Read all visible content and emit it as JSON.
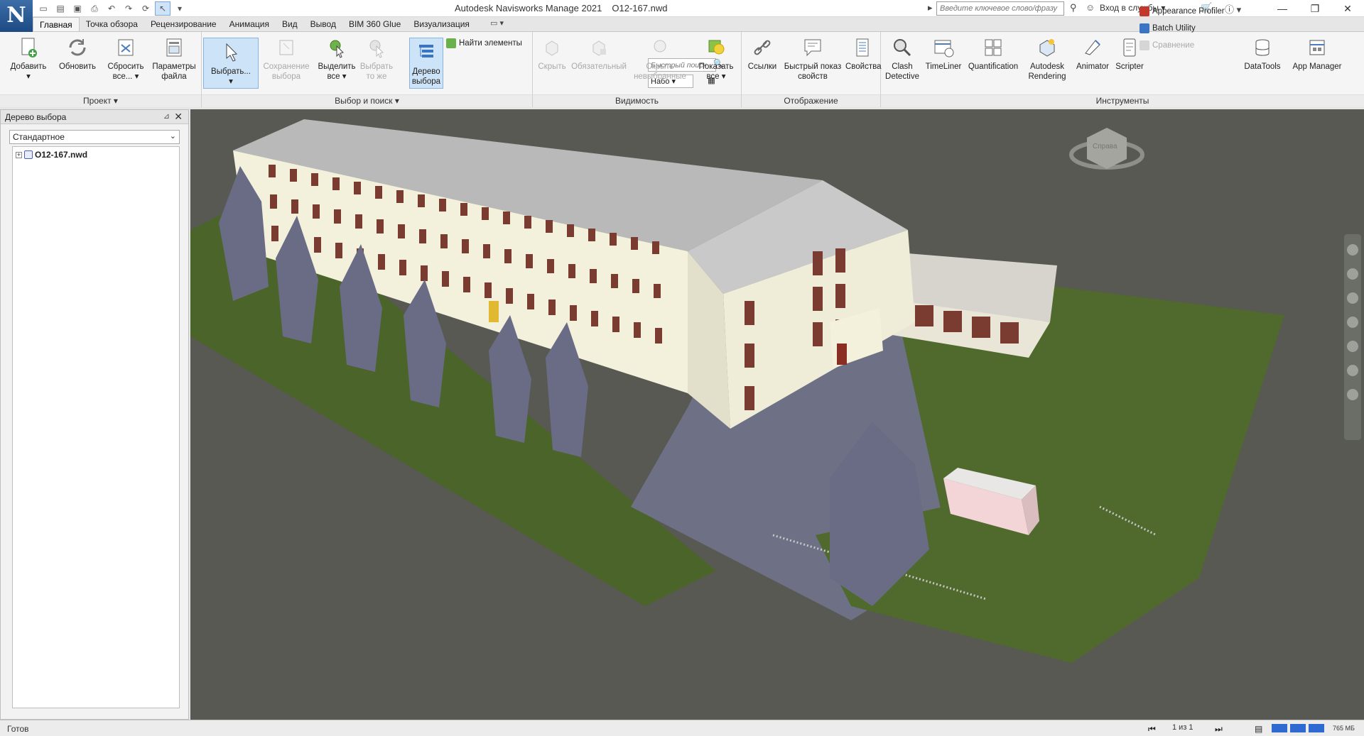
{
  "app": {
    "title": "Autodesk Navisworks Manage 2021",
    "filename": "O12-167.nwd",
    "logo_letter": "N",
    "search_placeholder": "Введите ключевое слово/фразу",
    "signin": "Вход в службы"
  },
  "tabs": [
    {
      "label": "Главная",
      "active": true
    },
    {
      "label": "Точка обзора"
    },
    {
      "label": "Рецензирование"
    },
    {
      "label": "Анимация"
    },
    {
      "label": "Вид"
    },
    {
      "label": "Вывод"
    },
    {
      "label": "BIM 360 Glue"
    },
    {
      "label": "Визуализация"
    }
  ],
  "ribbon": {
    "project": {
      "label": "Проект",
      "add": "Добавить",
      "refresh": "Обновить",
      "reset": "Сбросить все...",
      "file_options": "Параметры файла"
    },
    "select": {
      "label": "Выбор и поиск",
      "select": "Выбрать...",
      "save_selection": "Сохранение выбора",
      "select_all": "Выделить все",
      "select_same": "Выбрать то же",
      "selection_tree": "Дерево выбора",
      "find_items": "Найти элементы",
      "quick_find_placeholder": "Быстрый поиск",
      "sets_value": "Набо"
    },
    "visibility": {
      "label": "Видимость",
      "hide": "Скрыть",
      "required": "Обязательный",
      "hide_unselected": "Скрыть невыбранные",
      "show_all": "Показать все"
    },
    "display": {
      "label": "Отображение",
      "links": "Ссылки",
      "quick_properties": "Быстрый показ свойств",
      "properties": "Свойства"
    },
    "tools": {
      "label": "Инструменты",
      "clash": "Clash Detective",
      "timeliner": "TimeLiner",
      "quantification": "Quantification",
      "rendering": "Autodesk Rendering",
      "animator": "Animator",
      "scripter": "Scripter",
      "appearance_profiler": "Appearance Profiler",
      "batch_utility": "Batch Utility",
      "compare": "Сравнение",
      "datatools": "DataTools",
      "app_manager": "App Manager"
    }
  },
  "left_panel": {
    "title": "Дерево выбора",
    "mode": "Стандартное",
    "tree_item": "O12-167.nwd"
  },
  "viewcube": {
    "label": "Справа"
  },
  "status": {
    "text": "Готов",
    "pager": "1 из 1",
    "memory": "765 МБ"
  },
  "colors": {
    "accent": "#cde3f8",
    "viewport_bg": "#575952",
    "grass": "#4f6a2c",
    "pavement": "#6e7086",
    "facade": "#f3f0dc",
    "roof": "#bdbdbd",
    "tree": "#6a6c86"
  }
}
